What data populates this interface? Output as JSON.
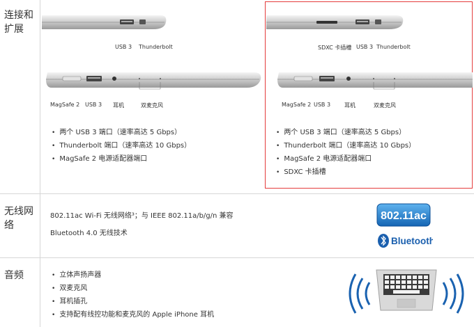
{
  "sections": {
    "ports_title": "连接和扩展",
    "wireless_title": "无线网络",
    "audio_title": "音频"
  },
  "left_model": {
    "side_a_ports": [
      "USB 3",
      "Thunderbolt"
    ],
    "side_b_ports": [
      "MagSafe 2",
      "USB 3",
      "耳机",
      "双麦克风"
    ],
    "features": [
      "两个 USB 3 端口（速率高达 5 Gbps）",
      "Thunderbolt 端口（速率高达 10 Gbps）",
      "MagSafe 2 电源适配器端口"
    ]
  },
  "right_model": {
    "side_a_ports": [
      "SDXC 卡插槽",
      "USB 3",
      "Thunderbolt"
    ],
    "side_b_ports": [
      "MagSafe 2",
      "USB 3",
      "耳机",
      "双麦克风"
    ],
    "features": [
      "两个 USB 3 端口（速率高达 5 Gbps）",
      "Thunderbolt 端口（速率高达 10 Gbps）",
      "MagSafe 2 电源适配器端口",
      "SDXC 卡插槽"
    ]
  },
  "wireless": {
    "wifi_line": "802.11ac Wi-Fi 无线网络³；与 IEEE 802.11a/b/g/n 兼容",
    "bt_line": "Bluetooth 4.0 无线技术",
    "badge_wifi": "802.11ac",
    "badge_bt": "Bluetooth"
  },
  "audio": {
    "features": [
      "立体声扬声器",
      "双麦克风",
      "耳机插孔",
      "支持配有线控功能和麦克风的 Apple iPhone 耳机"
    ]
  },
  "colors": {
    "highlight_border": "#e43c3c",
    "badge_blue": "#1e78c8",
    "sound_wave": "#1a62b0"
  }
}
